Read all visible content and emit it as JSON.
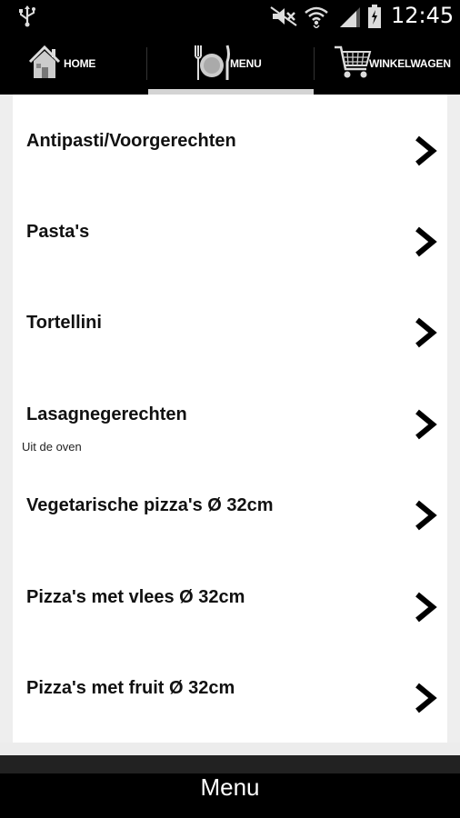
{
  "status_bar": {
    "time": "12:45",
    "icons": [
      "usb-icon",
      "mute-icon",
      "wifi-icon",
      "signal-icon",
      "battery-icon"
    ]
  },
  "tabs": [
    {
      "label": "HOME",
      "icon": "home-icon",
      "selected": false
    },
    {
      "label": "MENU",
      "icon": "plate-cutlery-icon",
      "selected": true
    },
    {
      "label": "WINKELWAGEN",
      "icon": "cart-icon",
      "selected": false
    }
  ],
  "menu_items": [
    {
      "title": "Antipasti/Voorgerechten",
      "subtitle": ""
    },
    {
      "title": "Pasta's",
      "subtitle": ""
    },
    {
      "title": "Tortellini",
      "subtitle": ""
    },
    {
      "title": "Lasagnegerechten",
      "subtitle": "Uit de oven"
    },
    {
      "title": "Vegetarische pizza's Ø 32cm",
      "subtitle": ""
    },
    {
      "title": "Pizza's met vlees Ø 32cm",
      "subtitle": ""
    },
    {
      "title": "Pizza's met fruit Ø 32cm",
      "subtitle": ""
    }
  ],
  "bottom_bar": {
    "title": "Menu"
  },
  "colors": {
    "bar": "#000000",
    "list_bg": "#ffffff",
    "page_bg": "#eeeeee",
    "tab_indicator": "#d4d4d4"
  }
}
